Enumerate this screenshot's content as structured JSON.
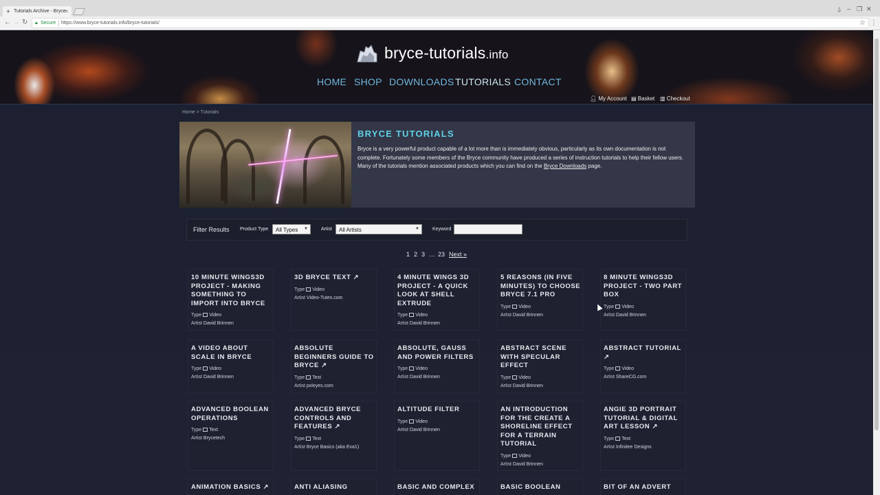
{
  "browser": {
    "tab_title": "Tutorials Archive - Bryce",
    "secure_label": "Secure",
    "url": "https://www.bryce-tutorials.info/bryce-tutorials/"
  },
  "site": {
    "logo_text": "bryce-tutorials",
    "logo_ext": ".info",
    "nav": [
      "HOME",
      "SHOP",
      "DOWNLOADS",
      "TUTORIALS",
      "CONTACT"
    ],
    "nav_active": "TUTORIALS",
    "account": [
      "My Account",
      "Basket",
      "Checkout"
    ]
  },
  "breadcrumb": "Home > Tutorials",
  "banner": {
    "title": "BRYCE TUTORIALS",
    "text_before": "Bryce is a very powerful product capable of a lot more than is immediately obvious, particularly as its own documentation is not complete. Fortunately some members of the Bryce community have produced a series of instruction tutorials to help their fellow users. Many of the tutorials mention associated products which you can find on the ",
    "link": "Bryce Downloads",
    "text_after": " page."
  },
  "filter": {
    "heading": "Filter Results",
    "product_type_label": "Product Type",
    "product_type_value": "All Types",
    "artist_label": "Artist",
    "artist_value": "All Artists",
    "keyword_label": "Keyword",
    "keyword_value": ""
  },
  "pagination": [
    "1",
    "2",
    "3",
    "…",
    "23",
    "Next »"
  ],
  "labels": {
    "type": "Type",
    "artist": "Artist"
  },
  "cards": [
    {
      "title": "10 MINUTE WINGS3D PROJECT - MAKING SOMETHING TO IMPORT INTO BRYCE",
      "type": "Video",
      "artist": "David Brinnen"
    },
    {
      "title": "3D BRYCE TEXT ↗",
      "type": "Video",
      "artist": "Video-Tutes.com"
    },
    {
      "title": "4 MINUTE WINGS 3D PROJECT - A QUICK LOOK AT SHELL EXTRUDE",
      "type": "Video",
      "artist": "David Brinnen"
    },
    {
      "title": "5 REASONS (IN FIVE MINUTES) TO CHOOSE BRYCE 7.1 PRO",
      "type": "Video",
      "artist": "David Brinnen"
    },
    {
      "title": "8 MINUTE WINGS3D PROJECT - TWO PART BOX",
      "type": "Video",
      "artist": "David Brinnen"
    },
    {
      "title": "A VIDEO ABOUT SCALE IN BRYCE",
      "type": "Video",
      "artist": "David Brinnen"
    },
    {
      "title": "ABSOLUTE BEGINNERS GUIDE TO BRYCE ↗",
      "type": "Text",
      "artist": "pxleyes.com"
    },
    {
      "title": "ABSOLUTE, GAUSS AND POWER FILTERS",
      "type": "Video",
      "artist": "David Brinnen"
    },
    {
      "title": "ABSTRACT SCENE WITH SPECULAR EFFECT",
      "type": "Video",
      "artist": "David Brinnen"
    },
    {
      "title": "ABSTRACT TUTORIAL ↗",
      "type": "Video",
      "artist": "ShareCG.com"
    },
    {
      "title": "ADVANCED BOOLEAN OPERATIONS",
      "type": "Text",
      "artist": "Brycetech"
    },
    {
      "title": "ADVANCED BRYCE CONTROLS AND FEATURES ↗",
      "type": "Text",
      "artist": "Bryce Basics (aka Eva1)"
    },
    {
      "title": "ALTITUDE FILTER",
      "type": "Video",
      "artist": "David Brinnen"
    },
    {
      "title": "AN INTRODUCTION FOR THE CREATE A SHORELINE EFFECT FOR A TERRAIN TUTORIAL",
      "type": "Video",
      "artist": "David Brinnen"
    },
    {
      "title": "ANGIE 3D PORTRAIT TUTORIAL & DIGITAL ART LESSON ↗",
      "type": "Text",
      "artist": "Infinitee Designs"
    },
    {
      "title": "ANIMATION BASICS ↗"
    },
    {
      "title": "ANTI ALIASING"
    },
    {
      "title": "BASIC AND COMPLEX"
    },
    {
      "title": "BASIC BOOLEAN"
    },
    {
      "title": "BIT OF AN ADVERT"
    }
  ]
}
